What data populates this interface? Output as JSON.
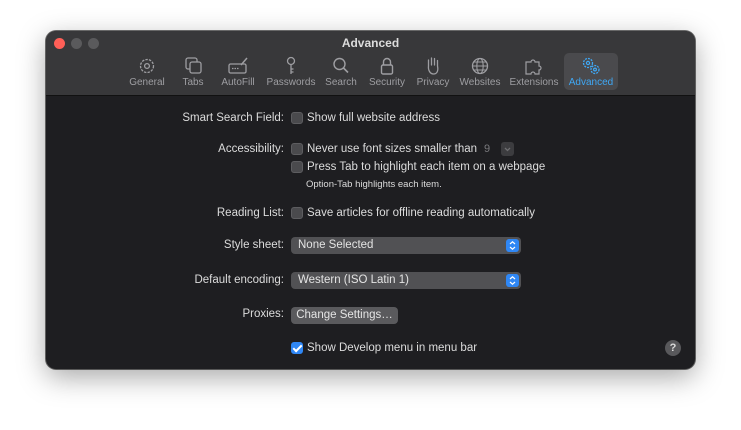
{
  "window": {
    "title": "Advanced"
  },
  "tabs": [
    {
      "label": "General",
      "icon": "gear-icon"
    },
    {
      "label": "Tabs",
      "icon": "tabs-icon"
    },
    {
      "label": "AutoFill",
      "icon": "autofill-icon"
    },
    {
      "label": "Passwords",
      "icon": "key-icon"
    },
    {
      "label": "Search",
      "icon": "search-icon"
    },
    {
      "label": "Security",
      "icon": "lock-icon"
    },
    {
      "label": "Privacy",
      "icon": "hand-icon"
    },
    {
      "label": "Websites",
      "icon": "globe-icon"
    },
    {
      "label": "Extensions",
      "icon": "puzzle-icon"
    },
    {
      "label": "Advanced",
      "icon": "gears-icon",
      "active": true
    }
  ],
  "settings": {
    "smart_search": {
      "label": "Smart Search Field:",
      "option": "Show full website address",
      "checked": false
    },
    "accessibility": {
      "label": "Accessibility:",
      "font_option": "Never use font sizes smaller than",
      "font_size": "9",
      "tab_option": "Press Tab to highlight each item on a webpage",
      "hint": "Option-Tab highlights each item."
    },
    "reading_list": {
      "label": "Reading List:",
      "option": "Save articles for offline reading automatically",
      "checked": false
    },
    "style_sheet": {
      "label": "Style sheet:",
      "value": "None Selected"
    },
    "encoding": {
      "label": "Default encoding:",
      "value": "Western (ISO Latin 1)"
    },
    "proxies": {
      "label": "Proxies:",
      "button": "Change Settings…"
    },
    "develop": {
      "option": "Show Develop menu in menu bar",
      "checked": true
    }
  },
  "help": {
    "label": "?"
  },
  "colors": {
    "accent": "#2f87f5",
    "active_tab_text": "#3fa8f5",
    "window_bg": "#1e1e21",
    "toolbar_bg": "#38383a"
  }
}
